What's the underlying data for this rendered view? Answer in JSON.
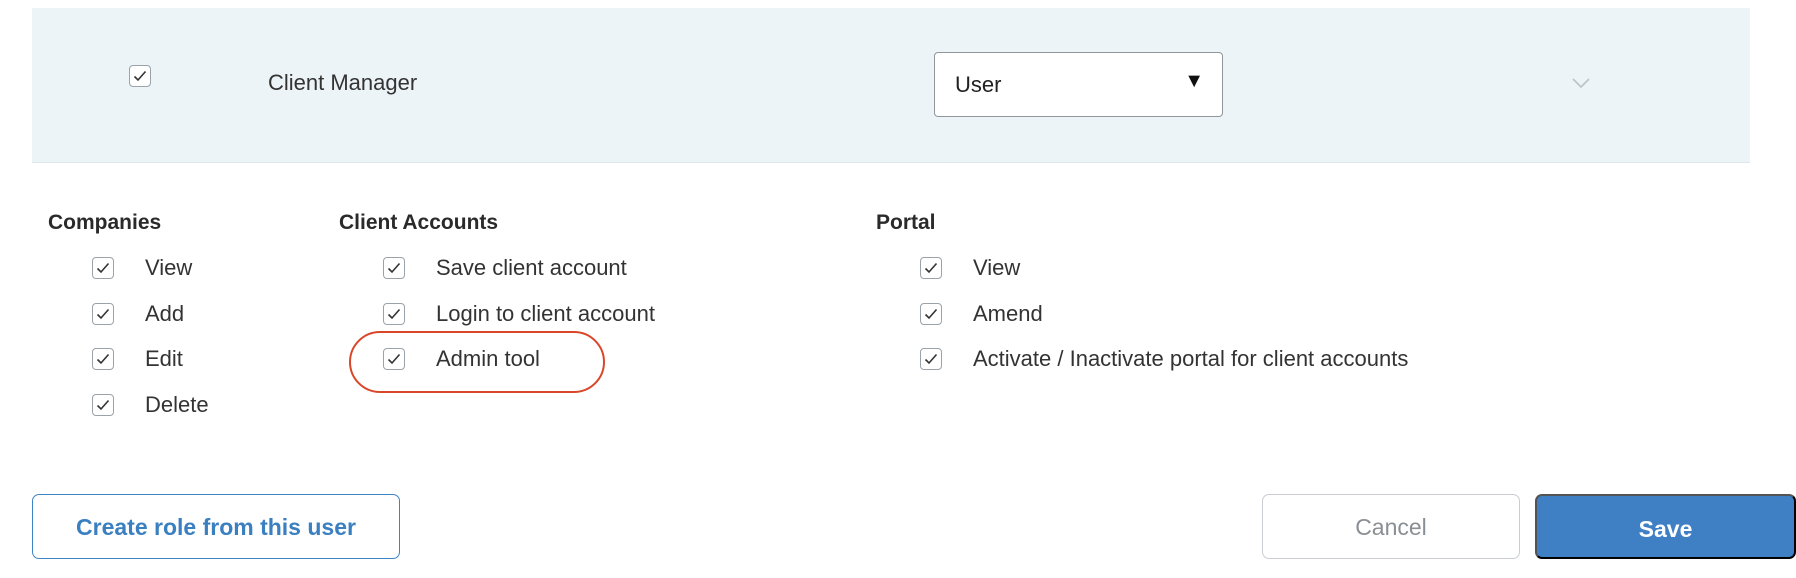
{
  "user_row": {
    "name": "Client Manager",
    "checked": true,
    "role_select": {
      "value": "User",
      "arrow": "▼"
    },
    "expand_icon": "chevron-down-icon"
  },
  "permissions": {
    "companies": {
      "title": "Companies",
      "items": [
        {
          "label": "View",
          "checked": true
        },
        {
          "label": "Add",
          "checked": true
        },
        {
          "label": "Edit",
          "checked": true
        },
        {
          "label": "Delete",
          "checked": true
        }
      ]
    },
    "client_accounts": {
      "title": "Client Accounts",
      "items": [
        {
          "label": "Save client account",
          "checked": true
        },
        {
          "label": "Login to client account",
          "checked": true
        },
        {
          "label": "Admin tool",
          "checked": true,
          "highlighted": true
        }
      ]
    },
    "portal": {
      "title": "Portal",
      "items": [
        {
          "label": "View",
          "checked": true
        },
        {
          "label": "Amend",
          "checked": true
        },
        {
          "label": "Activate / Inactivate portal for client accounts",
          "checked": true
        }
      ]
    }
  },
  "actions": {
    "create_role_label": "Create role from this user",
    "cancel_label": "Cancel",
    "save_label": "Save"
  },
  "colors": {
    "row_background": "#edf4f8",
    "accent": "#3f80c5",
    "highlight_ring": "#d9472b"
  }
}
